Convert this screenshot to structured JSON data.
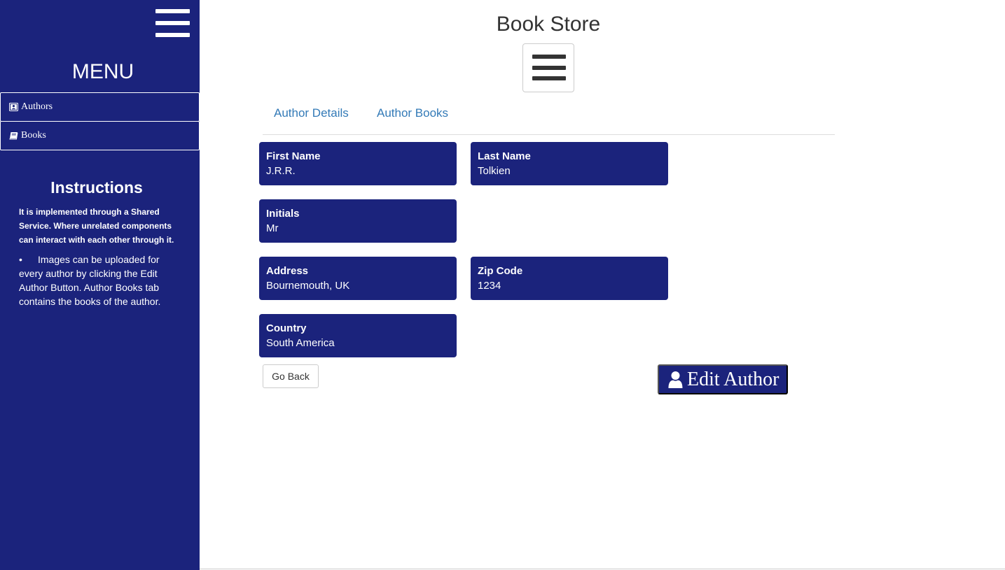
{
  "sidebar": {
    "menu_title": "MENU",
    "toggle_icon": "hamburger-icon",
    "items": [
      {
        "label": "Authors",
        "icon": "address-book-icon"
      },
      {
        "label": "Books",
        "icon": "book-icon"
      }
    ],
    "instructions": {
      "title": "Instructions",
      "paragraph": "It is implemented through a Shared Service. Where unrelated components can interact with each other through it.",
      "bullet": "•",
      "list_item": "Images can be uploaded for every author by clicking the Edit Author Button. Author Books tab contains the books of the author."
    }
  },
  "header": {
    "title": "Book Store",
    "toggle_icon": "hamburger-icon"
  },
  "tabs": [
    {
      "label": "Author Details"
    },
    {
      "label": "Author Books"
    }
  ],
  "author": {
    "first_name": {
      "label": "First Name",
      "value": "J.R.R."
    },
    "last_name": {
      "label": "Last Name",
      "value": "Tolkien"
    },
    "initials": {
      "label": "Initials",
      "value": "Mr"
    },
    "address": {
      "label": "Address",
      "value": "Bournemouth, UK"
    },
    "zip_code": {
      "label": "Zip Code",
      "value": "1234"
    },
    "country": {
      "label": "Country",
      "value": "South America"
    }
  },
  "actions": {
    "go_back": "Go Back",
    "edit_author": "Edit Author",
    "edit_icon": "user-icon"
  },
  "colors": {
    "primary": "#1b237c",
    "link": "#337ab7",
    "text": "#333333"
  }
}
